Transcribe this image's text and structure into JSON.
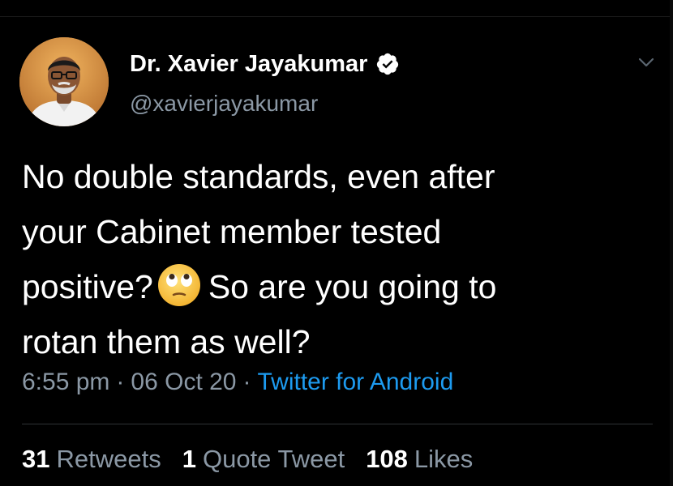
{
  "author": {
    "display_name": "Dr. Xavier Jayakumar",
    "handle": "@xavierjayakumar",
    "avatar_icon": "profile-photo",
    "verified_icon": "verified-badge-icon"
  },
  "tweet": {
    "lines": [
      "No double standards, even after",
      "your Cabinet member tested",
      "positive?",
      "So are you going to",
      "rotan them as well?"
    ],
    "emoji": "face-with-rolling-eyes-icon"
  },
  "meta": {
    "time": "6:55 pm",
    "separator": "·",
    "date": "06 Oct 20",
    "source": "Twitter for Android"
  },
  "stats": {
    "retweets_count": "31",
    "retweets_label": "Retweets",
    "quote_count": "1",
    "quote_label": "Quote Tweet",
    "likes_count": "108",
    "likes_label": "Likes"
  },
  "colors": {
    "background": "#000000",
    "text_primary": "#ffffff",
    "text_secondary": "#8b98a5",
    "link": "#1d9bf0",
    "divider": "#2f3336"
  }
}
